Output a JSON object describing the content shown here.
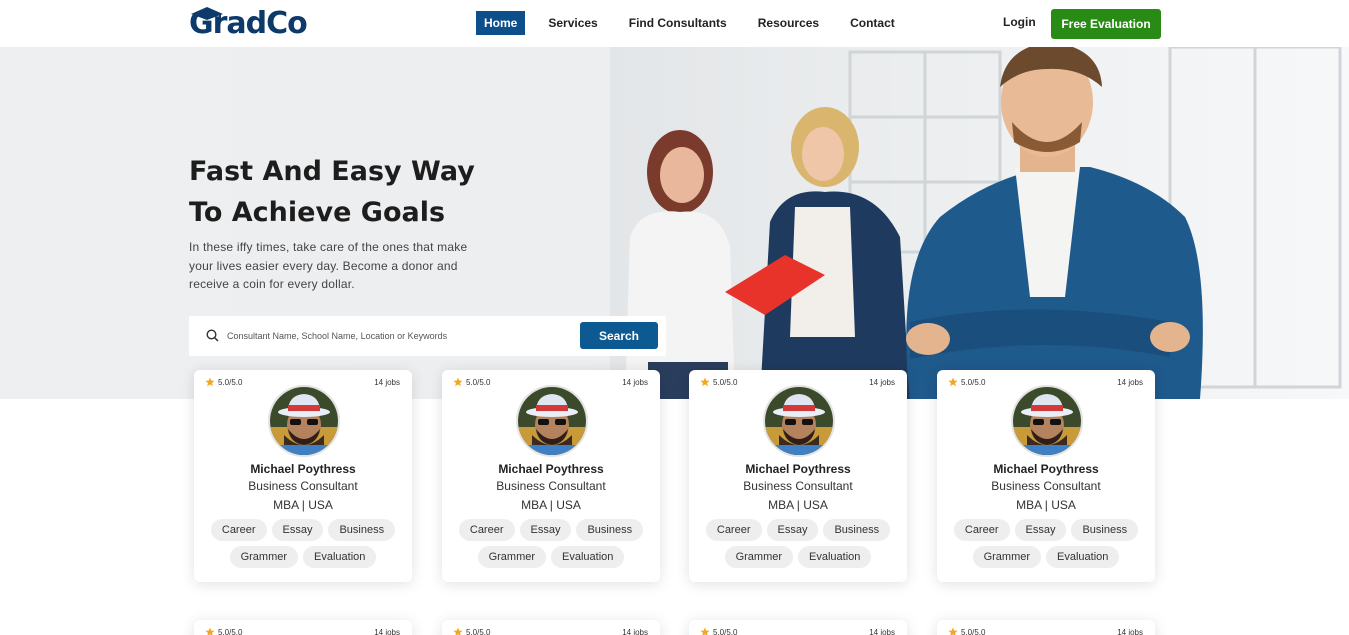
{
  "header": {
    "logo": "GradCo",
    "nav": [
      "Home",
      "Services",
      "Find Consultants",
      "Resources",
      "Contact"
    ],
    "login": "Login",
    "cta": "Free Evaluation"
  },
  "hero": {
    "title_line1": "Fast And Easy Way",
    "title_line2": "To Achieve Goals",
    "description": "In these iffy times, take care of the ones that make your lives easier every day. Become a donor and receive a coin for every dollar.",
    "search_placeholder": "Consultant Name, School Name, Location or Keywords",
    "search_button": "Search"
  },
  "colors": {
    "primary": "#0d4f8b",
    "cta_green": "#2a8a16",
    "star": "#f2a81d"
  },
  "consultants": [
    {
      "rating": "5.0/5.0",
      "jobs": "14 jobs",
      "name": "Michael Poythress",
      "role": "Business Consultant",
      "degree": "MBA | USA",
      "tags": [
        "Career",
        "Essay",
        "Business",
        "Grammer",
        "Evaluation"
      ]
    },
    {
      "rating": "5.0/5.0",
      "jobs": "14 jobs",
      "name": "Michael Poythress",
      "role": "Business Consultant",
      "degree": "MBA | USA",
      "tags": [
        "Career",
        "Essay",
        "Business",
        "Grammer",
        "Evaluation"
      ]
    },
    {
      "rating": "5.0/5.0",
      "jobs": "14 jobs",
      "name": "Michael Poythress",
      "role": "Business Consultant",
      "degree": "MBA | USA",
      "tags": [
        "Career",
        "Essay",
        "Business",
        "Grammer",
        "Evaluation"
      ]
    },
    {
      "rating": "5.0/5.0",
      "jobs": "14 jobs",
      "name": "Michael Poythress",
      "role": "Business Consultant",
      "degree": "MBA | USA",
      "tags": [
        "Career",
        "Essay",
        "Business",
        "Grammer",
        "Evaluation"
      ]
    }
  ],
  "consultants_row2": [
    {
      "rating": "5.0/5.0",
      "jobs": "14 jobs"
    },
    {
      "rating": "5.0/5.0",
      "jobs": "14 jobs"
    },
    {
      "rating": "5.0/5.0",
      "jobs": "14 jobs"
    },
    {
      "rating": "5.0/5.0",
      "jobs": "14 jobs"
    }
  ]
}
